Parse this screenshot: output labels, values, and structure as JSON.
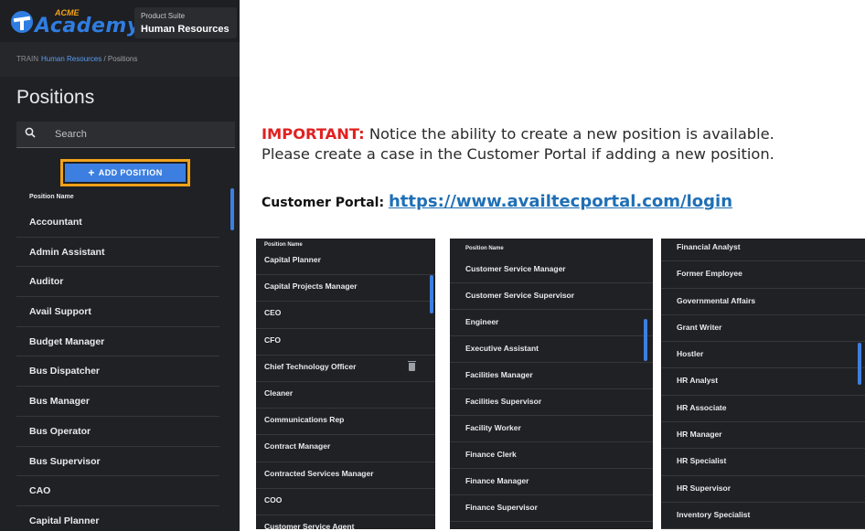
{
  "app": {
    "logo": {
      "acme": "ACME",
      "academy": "Academy"
    },
    "suite": {
      "label": "Product Suite",
      "value": "Human Resources"
    },
    "breadcrumb": {
      "env": "TRAIN",
      "link": "Human Resources",
      "sep": " / ",
      "current": "Positions"
    },
    "page_title": "Positions",
    "search": {
      "placeholder": "Search"
    },
    "add_button": {
      "plus": "+",
      "label": "ADD POSITION"
    },
    "list_header": "Position Name",
    "positions": [
      "Accountant",
      "Admin Assistant",
      "Auditor",
      "Avail Support",
      "Budget Manager",
      "Bus Dispatcher",
      "Bus Manager",
      "Bus Operator",
      "Bus Supervisor",
      "CAO",
      "Capital Planner"
    ]
  },
  "notice": {
    "important": "IMPORTANT:",
    "line1": " Notice the ability to create a new position is available.",
    "line2": "Please create a case in the Customer Portal if adding a new position."
  },
  "portal": {
    "label": "Customer Portal",
    "colon": ": ",
    "url": "https://www.availtecportal.com/login"
  },
  "panels": [
    {
      "header": "Position Name",
      "items": [
        "Capital Planner",
        "Capital Projects Manager",
        "CEO",
        "CFO",
        "Chief Technology Officer",
        "Cleaner",
        "Communications Rep",
        "Contract Manager",
        "Contracted Services Manager",
        "COO",
        "Customer Service Agent"
      ]
    },
    {
      "header": "Position Name",
      "items": [
        "Customer Service Manager",
        "Customer Service Supervisor",
        "Engineer",
        "Executive Assistant",
        "Facilities Manager",
        "Facilities Supervisor",
        "Facility Worker",
        "Finance Clerk",
        "Finance Manager",
        "Finance Supervisor"
      ]
    },
    {
      "header": "",
      "items": [
        "Financial Analyst",
        "Former Employee",
        "Governmental Affairs",
        "Grant Writer",
        "Hostler",
        "HR Analyst",
        "HR Associate",
        "HR Manager",
        "HR Specialist",
        "HR Supervisor",
        "Inventory Specialist"
      ]
    }
  ],
  "colors": {
    "accent": "#3d7fe0",
    "highlight": "#f0a21a",
    "important": "#e02020",
    "link": "#1f6fb5"
  }
}
